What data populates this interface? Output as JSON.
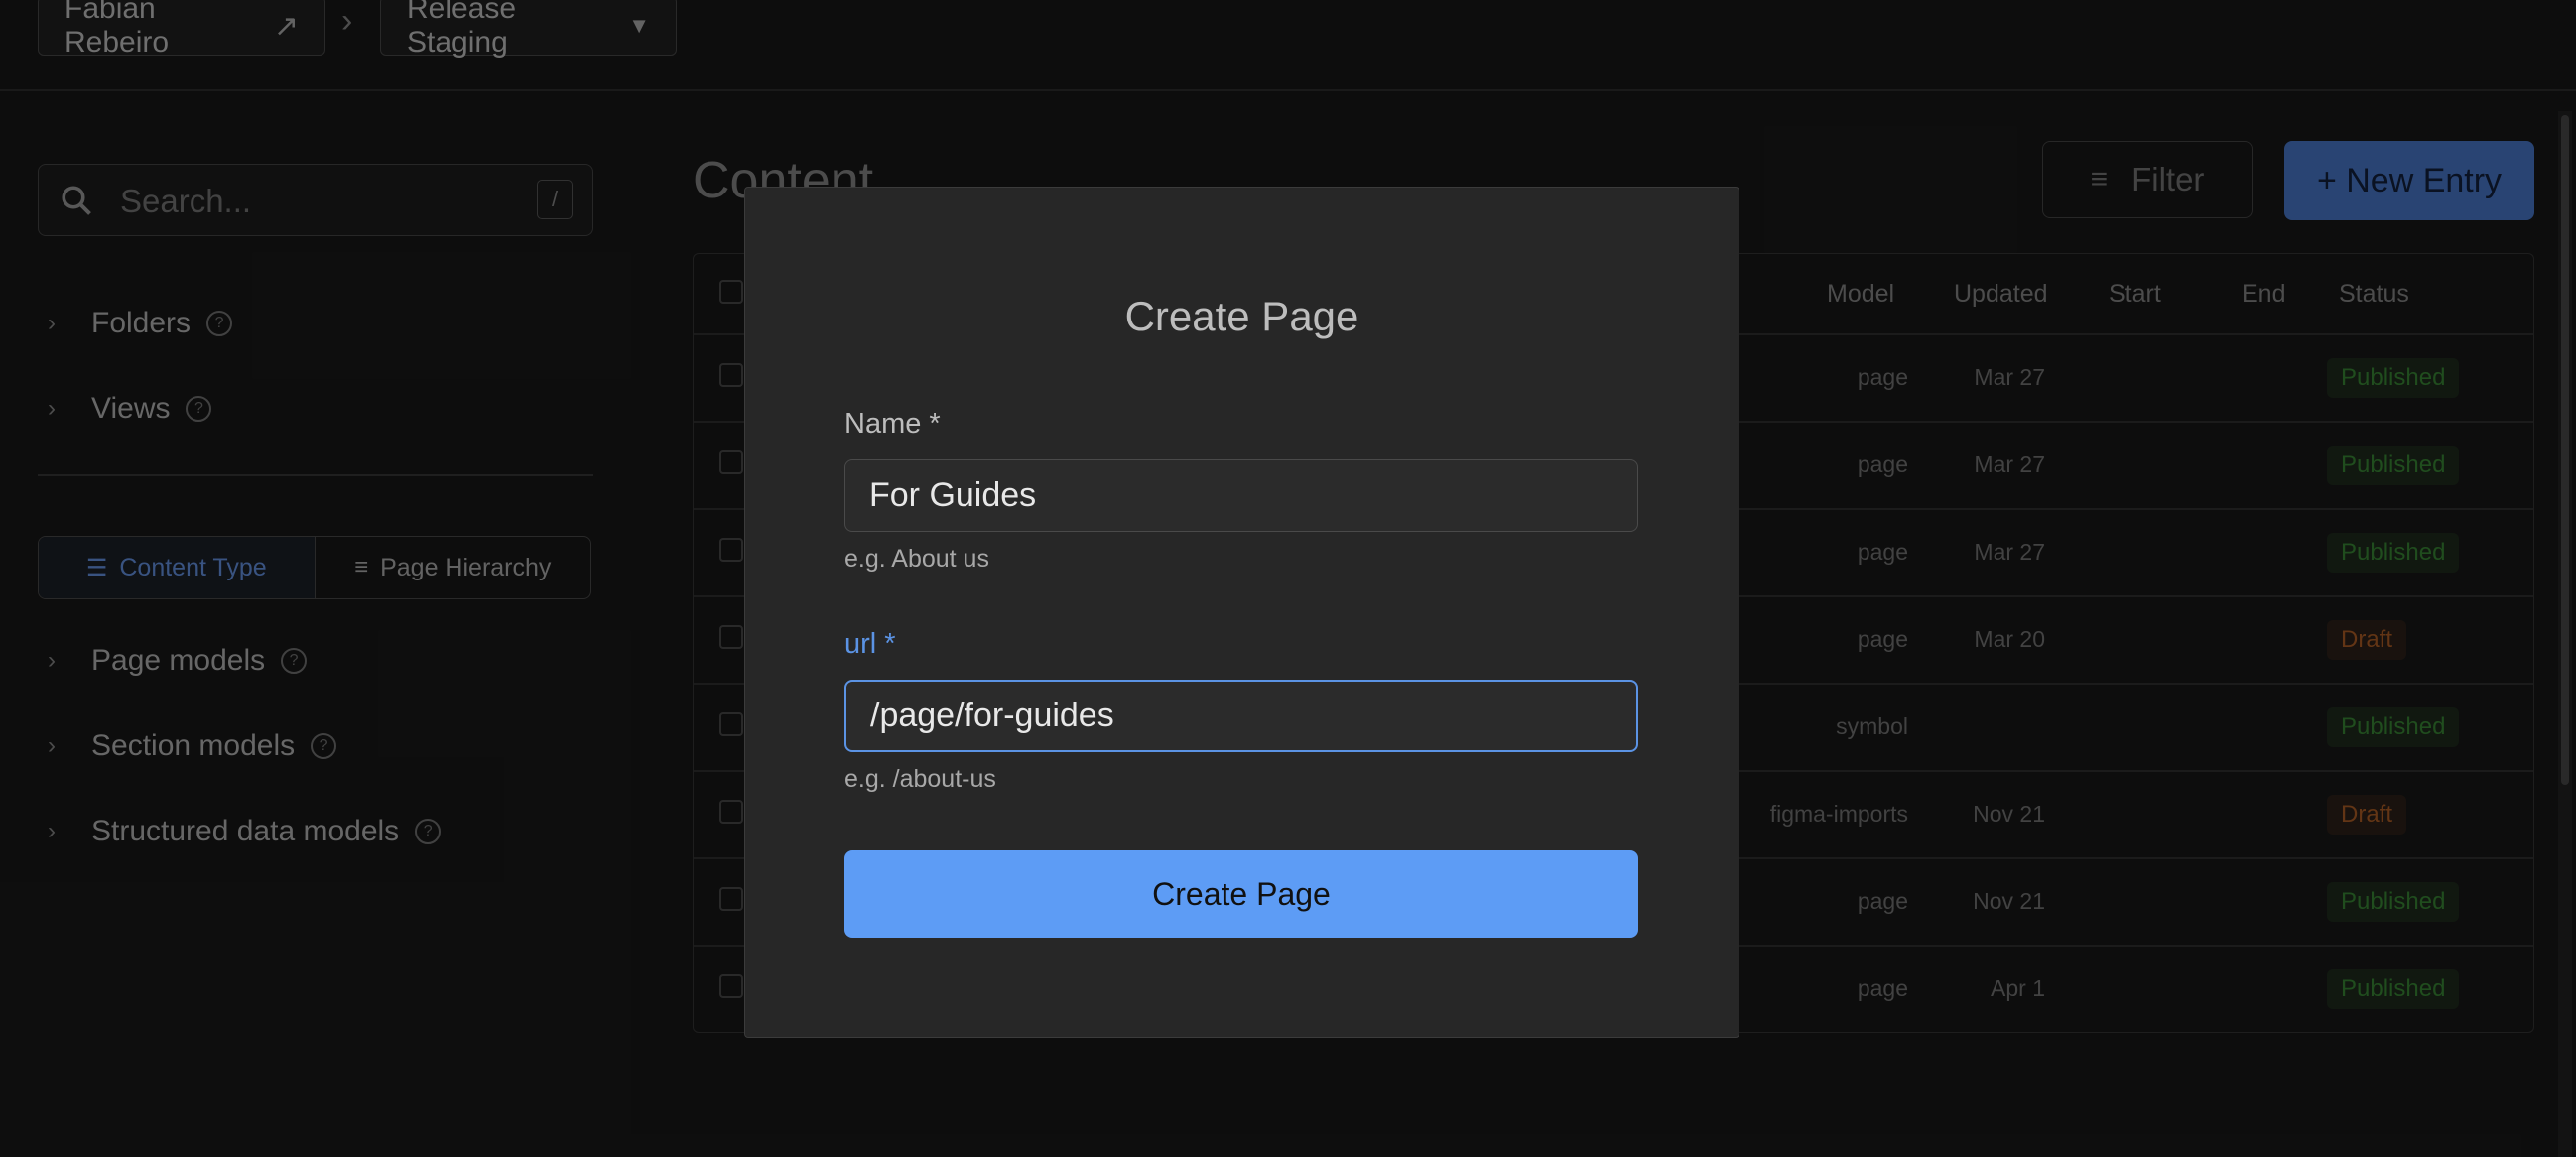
{
  "topbar": {
    "user": "Fabian Rebeiro",
    "environment": "Release Staging"
  },
  "sidebar": {
    "search_placeholder": "Search...",
    "search_shortcut": "/",
    "folders": "Folders",
    "views": "Views",
    "tab_content_type": "Content Type",
    "tab_page_hierarchy": "Page Hierarchy",
    "page_models": "Page models",
    "section_models": "Section models",
    "structured_data_models": "Structured data models"
  },
  "main": {
    "title": "Content",
    "filter_label": "Filter",
    "new_entry_label": "+ New Entry",
    "columns": [
      "Model",
      "Updated",
      "Start",
      "End",
      "Status"
    ],
    "rows": [
      {
        "model": "page",
        "updated": "Mar 27",
        "status": "Published"
      },
      {
        "model": "page",
        "updated": "Mar 27",
        "status": "Published"
      },
      {
        "model": "page",
        "updated": "Mar 27",
        "status": "Published"
      },
      {
        "model": "page",
        "updated": "Mar 20",
        "status": "Draft"
      },
      {
        "model": "symbol",
        "updated": "",
        "status": "Published"
      },
      {
        "model": "figma-imports",
        "updated": "Nov 21",
        "status": "Draft"
      },
      {
        "model": "page",
        "updated": "Nov 21",
        "status": "Published"
      },
      {
        "model": "page",
        "updated": "Apr 1",
        "status": "Published"
      }
    ]
  },
  "modal": {
    "title": "Create Page",
    "name_label": "Name *",
    "name_value": "For Guides",
    "name_hint": "e.g. About us",
    "url_label": "url *",
    "url_value": "/page/for-guides",
    "url_hint": "e.g. /about-us",
    "submit_label": "Create Page"
  },
  "colors": {
    "accent": "#5d9cf5",
    "published": "#2d6b2a",
    "draft": "#8a4a1e"
  }
}
